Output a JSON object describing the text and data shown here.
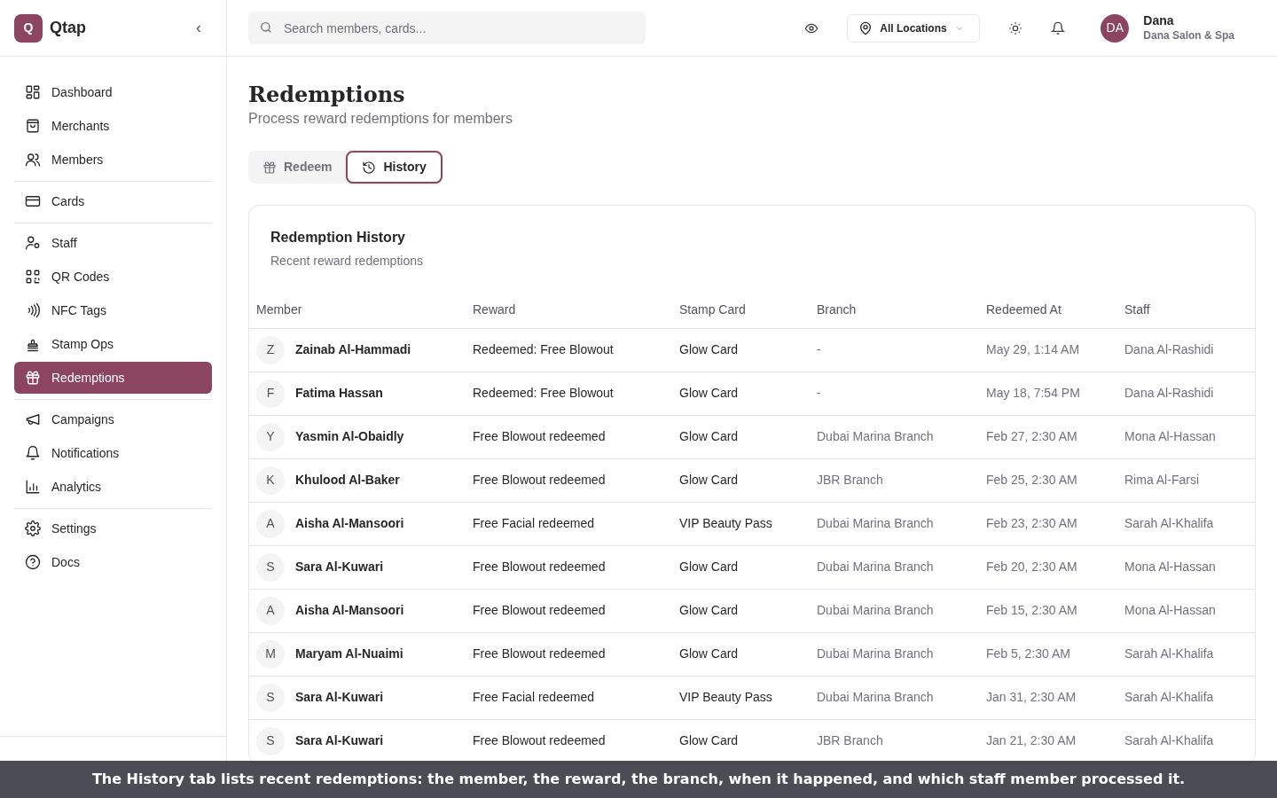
{
  "brand": {
    "logo_letter": "Q",
    "name": "Qtap",
    "collapse": "‹"
  },
  "sidebar": {
    "sections": [
      {
        "items": [
          {
            "label": "Dashboard",
            "selected": false
          },
          {
            "label": "Merchants",
            "selected": false
          },
          {
            "label": "Members",
            "selected": false
          }
        ]
      },
      {
        "items": [
          {
            "label": "Cards",
            "selected": false
          }
        ]
      },
      {
        "items": [
          {
            "label": "Staff",
            "selected": false
          },
          {
            "label": "QR Codes",
            "selected": false
          },
          {
            "label": "NFC Tags",
            "selected": false
          },
          {
            "label": "Stamp Ops",
            "selected": false
          },
          {
            "label": "Redemptions",
            "selected": true
          }
        ]
      },
      {
        "items": [
          {
            "label": "Campaigns",
            "selected": false
          },
          {
            "label": "Notifications",
            "selected": false
          },
          {
            "label": "Analytics",
            "selected": false
          }
        ]
      },
      {
        "items": [
          {
            "label": "Settings",
            "selected": false
          },
          {
            "label": "Docs",
            "selected": false
          }
        ]
      }
    ]
  },
  "header": {
    "search": {
      "placeholder": "Search members, cards..."
    },
    "location": "All Locations",
    "user": {
      "initials": "DA",
      "name": "Dana",
      "business": "Dana Salon & Spa"
    }
  },
  "page": {
    "title": "Redemptions",
    "subtitle": "Process reward redemptions for members"
  },
  "tabs": [
    {
      "label": "Redeem",
      "selected": false
    },
    {
      "label": "History",
      "selected": true
    }
  ],
  "card": {
    "title": "Redemption History",
    "subtitle": "Recent reward redemptions"
  },
  "table": {
    "columns": [
      "Member",
      "Reward",
      "Stamp Card",
      "Branch",
      "Redeemed At",
      "Staff"
    ],
    "rows": [
      {
        "initial": "Z",
        "member": "Zainab Al-Hammadi",
        "reward": "Redeemed: Free Blowout",
        "card": "Glow Card",
        "branch": "-",
        "at": "May 29, 1:14 AM",
        "staff": "Dana Al-Rashidi"
      },
      {
        "initial": "F",
        "member": "Fatima Hassan",
        "reward": "Redeemed: Free Blowout",
        "card": "Glow Card",
        "branch": "-",
        "at": "May 18, 7:54 PM",
        "staff": "Dana Al-Rashidi"
      },
      {
        "initial": "Y",
        "member": "Yasmin Al-Obaidly",
        "reward": "Free Blowout redeemed",
        "card": "Glow Card",
        "branch": "Dubai Marina Branch",
        "at": "Feb 27, 2:30 AM",
        "staff": "Mona Al-Hassan"
      },
      {
        "initial": "K",
        "member": "Khulood Al-Baker",
        "reward": "Free Blowout redeemed",
        "card": "Glow Card",
        "branch": "JBR Branch",
        "at": "Feb 25, 2:30 AM",
        "staff": "Rima Al-Farsi"
      },
      {
        "initial": "A",
        "member": "Aisha Al-Mansoori",
        "reward": "Free Facial redeemed",
        "card": "VIP Beauty Pass",
        "branch": "Dubai Marina Branch",
        "at": "Feb 23, 2:30 AM",
        "staff": "Sarah Al-Khalifa"
      },
      {
        "initial": "S",
        "member": "Sara Al-Kuwari",
        "reward": "Free Blowout redeemed",
        "card": "Glow Card",
        "branch": "Dubai Marina Branch",
        "at": "Feb 20, 2:30 AM",
        "staff": "Mona Al-Hassan"
      },
      {
        "initial": "A",
        "member": "Aisha Al-Mansoori",
        "reward": "Free Blowout redeemed",
        "card": "Glow Card",
        "branch": "Dubai Marina Branch",
        "at": "Feb 15, 2:30 AM",
        "staff": "Mona Al-Hassan"
      },
      {
        "initial": "M",
        "member": "Maryam Al-Nuaimi",
        "reward": "Free Blowout redeemed",
        "card": "Glow Card",
        "branch": "Dubai Marina Branch",
        "at": "Feb 5, 2:30 AM",
        "staff": "Sarah Al-Khalifa"
      },
      {
        "initial": "S",
        "member": "Sara Al-Kuwari",
        "reward": "Free Facial redeemed",
        "card": "VIP Beauty Pass",
        "branch": "Dubai Marina Branch",
        "at": "Jan 31, 2:30 AM",
        "staff": "Sarah Al-Khalifa"
      },
      {
        "initial": "S",
        "member": "Sara Al-Kuwari",
        "reward": "Free Blowout redeemed",
        "card": "Glow Card",
        "branch": "JBR Branch",
        "at": "Jan 21, 2:30 AM",
        "staff": "Sarah Al-Khalifa"
      }
    ]
  },
  "caption": "The History tab lists recent redemptions: the member, the reward, the branch, when it happened, and which staff member processed it."
}
